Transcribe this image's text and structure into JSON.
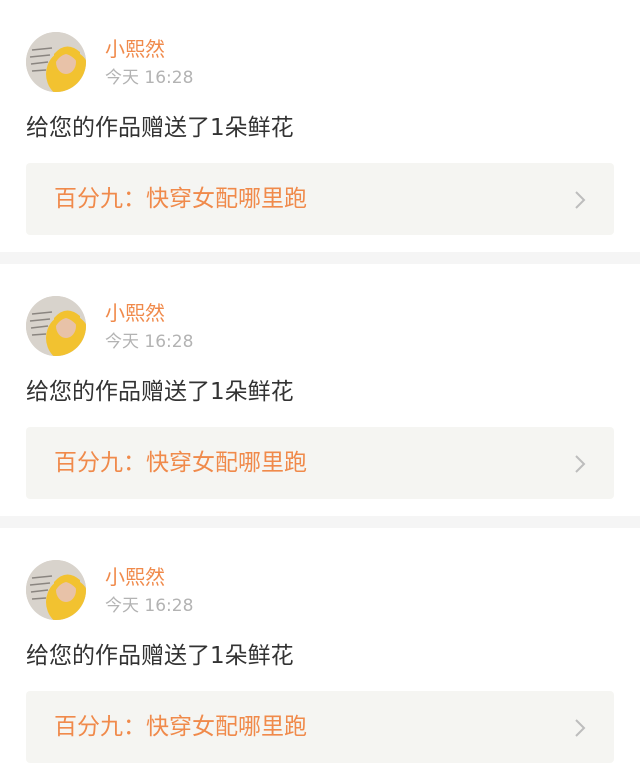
{
  "notifications": [
    {
      "username": "小熙然",
      "time": "今天 16:28",
      "message": "给您的作品赠送了1朵鲜花",
      "work_title": "百分九：快穿女配哪里跑"
    },
    {
      "username": "小熙然",
      "time": "今天 16:28",
      "message": "给您的作品赠送了1朵鲜花",
      "work_title": "百分九：快穿女配哪里跑"
    },
    {
      "username": "小熙然",
      "time": "今天 16:28",
      "message": "给您的作品赠送了1朵鲜花",
      "work_title": "百分九：快穿女配哪里跑"
    }
  ],
  "icons": {
    "chevron": "chevron-right-icon",
    "avatar": "avatar"
  },
  "colors": {
    "accent": "#f08a4b",
    "muted": "#b3b3b3",
    "text": "#333333",
    "link_bg": "#f5f5f2",
    "divider": "#f5f5f5"
  }
}
